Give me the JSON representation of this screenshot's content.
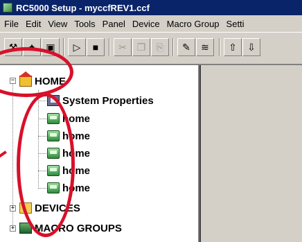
{
  "window": {
    "title": "RC5000 Setup - myccfREV1.ccf"
  },
  "menu": {
    "items": [
      {
        "label": "File"
      },
      {
        "label": "Edit"
      },
      {
        "label": "View"
      },
      {
        "label": "Tools"
      },
      {
        "label": "Panel"
      },
      {
        "label": "Device"
      },
      {
        "label": "Macro Group"
      },
      {
        "label": "Setti"
      }
    ]
  },
  "toolbar": {
    "buttons": [
      {
        "icon": "new-device-icon",
        "glyph": "⚒"
      },
      {
        "icon": "add-device-icon",
        "glyph": "✦"
      },
      {
        "icon": "add-panel-icon",
        "glyph": "▣"
      },
      {
        "icon": "open-icon",
        "glyph": "▷"
      },
      {
        "icon": "save-icon",
        "glyph": "■"
      },
      {
        "icon": "cut-icon",
        "glyph": "✂"
      },
      {
        "icon": "copy-icon",
        "glyph": "❐"
      },
      {
        "icon": "paste-icon",
        "glyph": "⎘"
      },
      {
        "icon": "edit-icon",
        "glyph": "✎"
      },
      {
        "icon": "ir-learn-icon",
        "glyph": "≋"
      },
      {
        "icon": "upload-icon",
        "glyph": "⇧"
      },
      {
        "icon": "download-icon",
        "glyph": "⇩"
      }
    ]
  },
  "tree": {
    "root": {
      "label": "HOME",
      "expander": "−"
    },
    "children": [
      {
        "label": "System Properties"
      },
      {
        "label": "home"
      },
      {
        "label": "home"
      },
      {
        "label": "home"
      },
      {
        "label": "home"
      },
      {
        "label": "home"
      }
    ],
    "siblings": [
      {
        "label": "DEVICES",
        "expander": "+"
      },
      {
        "label": "MACRO GROUPS",
        "expander": "+"
      }
    ]
  },
  "annotation": {
    "color": "#d8102a"
  }
}
